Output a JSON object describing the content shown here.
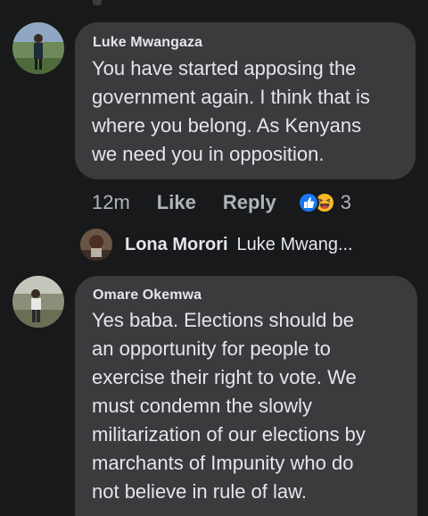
{
  "comments": [
    {
      "author": "Luke Mwangaza",
      "text": "You have started apposing the\ngovernment again. I think that is\nwhere you belong. As Kenyans\nwe need you in opposition."
    },
    {
      "author": "Omare Okemwa",
      "text": "Yes baba. Elections should be\nan opportunity for people to\nexercise their right to vote. We\nmust condemn the slowly\nmilitarization of our elections by\nmarchants of Impunity who do\nnot believe in rule of law."
    }
  ],
  "meta": {
    "time": "12m",
    "like_label": "Like",
    "reply_label": "Reply",
    "reaction_icons": [
      "like-icon",
      "haha-icon"
    ],
    "reaction_count": "3"
  },
  "reply_preview": {
    "author": "Lona Morori",
    "text": "Luke Mwang..."
  },
  "colors": {
    "background": "#18191a",
    "bubble": "#3a3b3c",
    "text": "#e4e6eb",
    "secondary_text": "#b0b3b8",
    "like_blue": "#1877f2",
    "haha_yellow": "#f7b928"
  }
}
